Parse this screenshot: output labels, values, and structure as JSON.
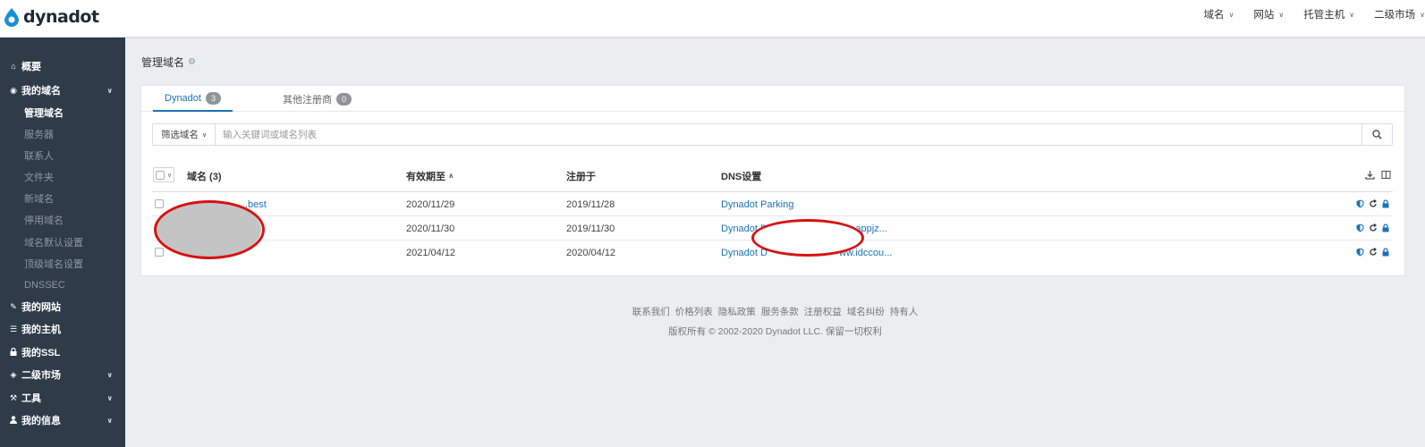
{
  "brand": {
    "name": "dynadot",
    "accent": "#1a73b5",
    "sidebar_bg": "#2f3b49"
  },
  "topnav": [
    {
      "label": "域名"
    },
    {
      "label": "网站"
    },
    {
      "label": "托管主机"
    },
    {
      "label": "二级市场"
    }
  ],
  "sidebar": {
    "overview": "概要",
    "my_domains": "我的域名",
    "sub_items": [
      "管理域名",
      "服务器",
      "联系人",
      "文件夹",
      "新域名",
      "停用域名",
      "域名默认设置",
      "顶级域名设置",
      "DNSSEC"
    ],
    "my_sites": "我的网站",
    "my_hosting": "我的主机",
    "my_ssl": "我的SSL",
    "aftermarket": "二级市场",
    "tools": "工具",
    "my_info": "我的信息"
  },
  "page_title": "管理域名",
  "tabs": [
    {
      "label": "Dynadot",
      "count": "3"
    },
    {
      "label": "其他注册商",
      "count": "0"
    }
  ],
  "search": {
    "filter_label": "筛选域名",
    "placeholder": "输入关键词或域名列表",
    "value": ""
  },
  "table": {
    "columns": {
      "domain": "域名 (3)",
      "expires": "有效期至",
      "registered": "注册于",
      "dns": "DNS设置"
    },
    "rows": [
      {
        "domain": ".best",
        "expires": "2020/11/29",
        "registered": "2019/11/28",
        "dns": "Dynadot Parking",
        "dns_tail": ""
      },
      {
        "domain": "",
        "expires": "2020/11/30",
        "registered": "2019/11/30",
        "dns": "Dynadot D",
        "dns_tail": "ww.appjz..."
      },
      {
        "domain": "",
        "expires": "2021/04/12",
        "registered": "2020/04/12",
        "dns": "Dynadot D",
        "dns_tail": "ww.idccou..."
      }
    ]
  },
  "footer": {
    "links": [
      "联系我们",
      "价格列表",
      "隐私政策",
      "服务条款",
      "注册权益",
      "域名纠纷",
      "持有人"
    ],
    "copyright": "版权所有 © 2002-2020 Dynadot LLC. 保留一切权利"
  }
}
